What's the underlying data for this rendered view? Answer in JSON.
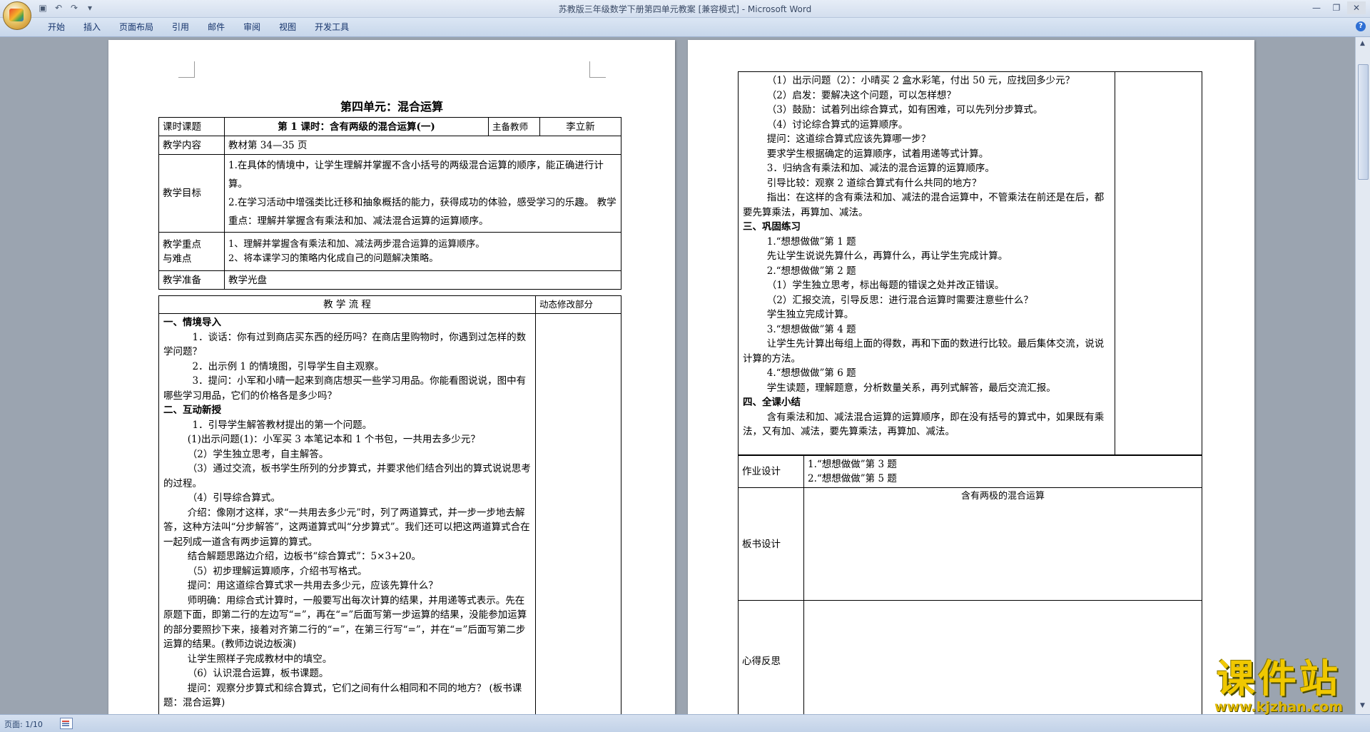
{
  "window": {
    "title": "苏教版三年级数学下册第四单元教案 [兼容模式] - Microsoft Word",
    "qat": [
      "save",
      "undo",
      "redo",
      "customize"
    ]
  },
  "ribbon": {
    "tabs": [
      "开始",
      "插入",
      "页面布局",
      "引用",
      "邮件",
      "审阅",
      "视图",
      "开发工具"
    ],
    "help": "?"
  },
  "status": {
    "page": "页面: 1/10"
  },
  "watermark": {
    "main": "课件站",
    "url": "www.kjzhan.com"
  },
  "page1": {
    "title": "第四单元：混合运算",
    "header": {
      "lesson_label": "课时课题",
      "lesson_value": "第 1 课时：含有两级的混合运算(一)",
      "teacher_label": "主备教师",
      "teacher_value": "李立新"
    },
    "content": {
      "label": "教学内容",
      "value": "教材第 34—35 页"
    },
    "goals": {
      "label": "教学目标",
      "lines": [
        "1.在具体的情境中，让学生理解并掌握不含小括号的两级混合运算的顺序，能正确进行计算。",
        "2.在学习活动中增强类比迁移和抽象概括的能力，获得成功的体验，感受学习的乐趣。 教学重点：理解并掌握含有乘法和加、减法混合运算的运算顺序。"
      ]
    },
    "keypoints": {
      "label_1": "教学重点",
      "label_2": "与难点",
      "lines": [
        "1、理解并掌握含有乘法和加、减法两步混合运算的运算顺序。",
        "2、将本课学习的策略内化成自己的问题解决策略。"
      ]
    },
    "prep": {
      "label": "教学准备",
      "value": "教学光盘"
    },
    "flow_header": "教  学  流  程",
    "revise_header": "动态修改部分",
    "flow": [
      {
        "t": "一、情境导入",
        "c": "h"
      },
      {
        "t": "1．谈话：你有过到商店买东西的经历吗？在商店里购物时，你遇到过怎样的数学问题？",
        "c": "ind3"
      },
      {
        "t": "2．出示例 1 的情境图，引导学生自主观察。",
        "c": "ind3"
      },
      {
        "t": "3．提问：小军和小晴一起来到商店想买一些学习用品。你能看图说说，图中有哪些学习用品，它们的价格各是多少吗？",
        "c": "ind3"
      },
      {
        "t": "二、互动新授",
        "c": "h"
      },
      {
        "t": "1．引导学生解答教材提出的第一个问题。",
        "c": "ind3"
      },
      {
        "t": "(1)出示问题(1)：小军买 3 本笔记本和 1 个书包，一共用去多少元？",
        "c": "ind2"
      },
      {
        "t": "（2）学生独立思考，自主解答。",
        "c": "ind2"
      },
      {
        "t": "（3）通过交流，板书学生所列的分步算式，并要求他们结合列出的算式说说思考的过程。",
        "c": "ind2"
      },
      {
        "t": "（4）引导综合算式。",
        "c": "ind2"
      },
      {
        "t": "介绍：像刚才这样，求“一共用去多少元”时，列了两道算式，并一步一步地去解答，这种方法叫“分步解答”，这两道算式叫“分步算式”。我们还可以把这两道算式合在一起列成一道含有两步运算的算式。",
        "c": "ind2"
      },
      {
        "t": "结合解题思路边介绍，边板书“综合算式”：5×3+20。",
        "c": "ind2"
      },
      {
        "t": "（5）初步理解运算顺序，介绍书写格式。",
        "c": "ind2"
      },
      {
        "t": "提问：用这道综合算式求一共用去多少元，应该先算什么？",
        "c": "ind2"
      },
      {
        "t": "师明确：用综合式计算时，一般要写出每次计算的结果，并用递等式表示。先在原题下面，即第二行的左边写“=”，再在“=”后面写第一步运算的结果，没能参加运算的部分要照抄下来，接着对齐第二行的“=”，在第三行写“=”，并在“=”后面写第二步运算的结果。(教师边说边板演)",
        "c": "ind2"
      },
      {
        "t": "让学生照样子完成教材中的填空。",
        "c": "ind2"
      },
      {
        "t": "（6）认识混合运算，板书课题。",
        "c": "ind2"
      },
      {
        "t": "提问：观察分步算式和综合算式，它们之间有什么相同和不同的地方？              (板书课题：混合运算)",
        "c": "ind2"
      }
    ]
  },
  "page2": {
    "flow": [
      {
        "t": "（1）出示问题（2）：小晴买 2 盒水彩笔，付出 50 元，应找回多少元？",
        "c": "ind2"
      },
      {
        "t": "（2）启发：要解决这个问题，可以怎样想？",
        "c": "ind2"
      },
      {
        "t": "（3）鼓励：试着列出综合算式，如有困难，可以先列分步算式。",
        "c": "ind2"
      },
      {
        "t": "（4）讨论综合算式的运算顺序。",
        "c": "ind2"
      },
      {
        "t": "提问：这道综合算式应该先算哪一步？",
        "c": "ind2"
      },
      {
        "t": "要求学生根据确定的运算顺序，试着用递等式计算。",
        "c": "ind2"
      },
      {
        "t": "3．归纳含有乘法和加、减法的混合运算的运算顺序。",
        "c": "ind2"
      },
      {
        "t": "引导比较：观察 2 道综合算式有什么共同的地方？",
        "c": "ind2"
      },
      {
        "t": "指出：在这样的含有乘法和加、减法的混合运算中，不管乘法在前还是在后，都要先算乘法，再算加、减法。",
        "c": "ind2"
      },
      {
        "t": "三、巩固练习",
        "c": "h"
      },
      {
        "t": "1.“想想做做”第 1 题",
        "c": "ind2"
      },
      {
        "t": "先让学生说说先算什么，再算什么，再让学生完成计算。",
        "c": "ind2"
      },
      {
        "t": "2.“想想做做”第 2 题",
        "c": "ind2"
      },
      {
        "t": "（1）学生独立思考，标出每题的错误之处并改正错误。",
        "c": "ind2"
      },
      {
        "t": "（2）汇报交流，引导反思：进行混合运算时需要注意些什么？",
        "c": "ind2"
      },
      {
        "t": "学生独立完成计算。",
        "c": "ind2"
      },
      {
        "t": "3.“想想做做”第 4 题",
        "c": "ind2"
      },
      {
        "t": "让学生先计算出每组上面的得数，再和下面的数进行比较。最后集体交流，说说计算的方法。",
        "c": "ind2"
      },
      {
        "t": "4.“想想做做”第 6 题",
        "c": "ind2"
      },
      {
        "t": "学生读题，理解题意，分析数量关系，再列式解答，最后交流汇报。",
        "c": "ind2"
      },
      {
        "t": "四、全课小结",
        "c": "h"
      },
      {
        "t": "含有乘法和加、减法混合运算的运算顺序，即在没有括号的算式中，如果既有乘法，又有加、减法，要先算乘法，再算加、减法。",
        "c": "ind2"
      }
    ],
    "homework": {
      "label": "作业设计",
      "lines": [
        "1.“想想做做”第 3 题",
        "2.“想想做做”第 5 题"
      ]
    },
    "board": {
      "label": "板书设计",
      "title": "含有两极的混合运算"
    },
    "reflection": {
      "label": "心得反思"
    }
  }
}
